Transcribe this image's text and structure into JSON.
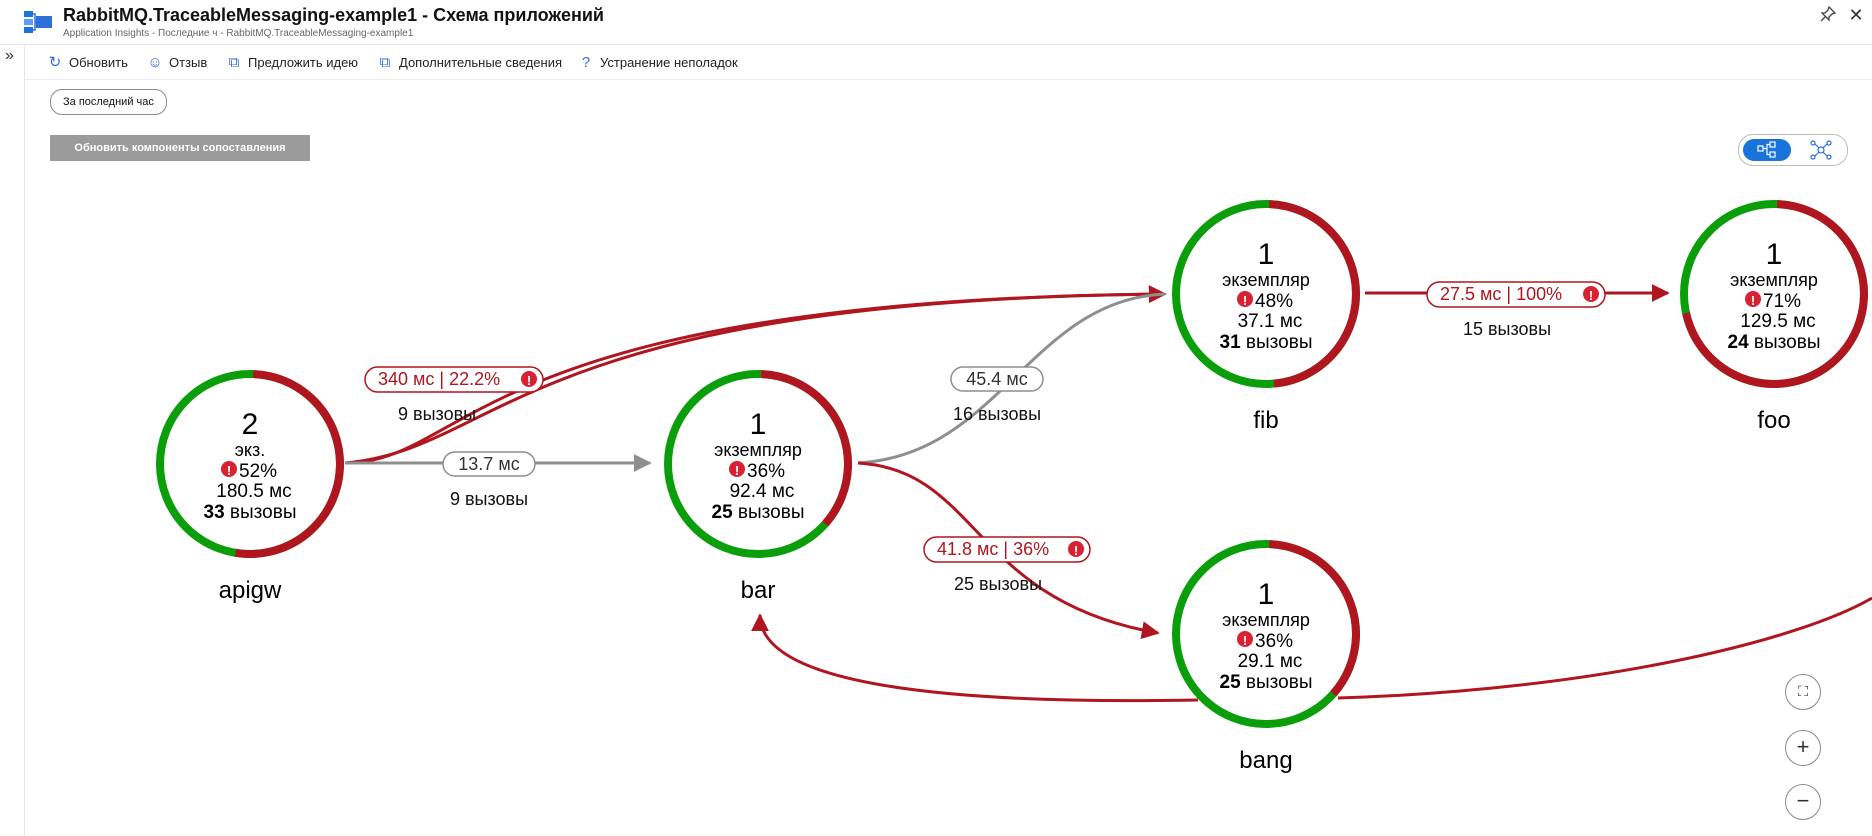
{
  "header": {
    "title": "RabbitMQ.TraceableMessaging-example1 - Схема приложений",
    "breadcrumb": "Application Insights - Последние ч - RabbitMQ.TraceableMessaging-example1"
  },
  "toolbar": {
    "refresh": "Обновить",
    "feedback": "Отзыв",
    "suggest": "Предложить идею",
    "more_info": "Дополнительные сведения",
    "troubleshoot": "Устранение неполадок"
  },
  "filter": {
    "time_range": "За последний час"
  },
  "actions": {
    "refresh_components": "Обновить компоненты сопоставления"
  },
  "colors": {
    "healthy": "#0b9e0b",
    "failed": "#b0161f",
    "neutral": "#8e8e8e",
    "accent": "#1a73d9"
  },
  "nodes": {
    "apigw": {
      "name": "apigw",
      "count": "2",
      "label": "экз.",
      "error": "52%",
      "latency": "180.5 мс",
      "calls_num": "33",
      "calls_word": "вызовы",
      "fail_fraction": 0.52
    },
    "bar": {
      "name": "bar",
      "count": "1",
      "label": "экземпляр",
      "error": "36%",
      "latency": "92.4 мс",
      "calls_num": "25",
      "calls_word": "вызовы",
      "fail_fraction": 0.36
    },
    "fib": {
      "name": "fib",
      "count": "1",
      "label": "экземпляр",
      "error": "48%",
      "latency": "37.1 мс",
      "calls_num": "31",
      "calls_word": "вызовы",
      "fail_fraction": 0.48
    },
    "foo": {
      "name": "foo",
      "count": "1",
      "label": "экземпляр",
      "error": "71%",
      "latency": "129.5 мс",
      "calls_num": "24",
      "calls_word": "вызовы",
      "fail_fraction": 0.71
    },
    "bang": {
      "name": "bang",
      "count": "1",
      "label": "экземпляр",
      "error": "36%",
      "latency": "29.1 мс",
      "calls_num": "25",
      "calls_word": "вызовы",
      "fail_fraction": 0.36
    }
  },
  "edges": {
    "apigw_fib": {
      "metric": "340 мс | 22.2%",
      "calls": "9 вызовы"
    },
    "apigw_bar": {
      "metric": "13.7 мс",
      "calls": "9 вызовы"
    },
    "bar_fib": {
      "metric": "45.4 мс",
      "calls": "16 вызовы"
    },
    "fib_foo": {
      "metric": "27.5 мс | 100%",
      "calls": "15 вызовы"
    },
    "bar_bang": {
      "metric": "41.8 мс | 36%",
      "calls": "25 вызовы"
    }
  }
}
